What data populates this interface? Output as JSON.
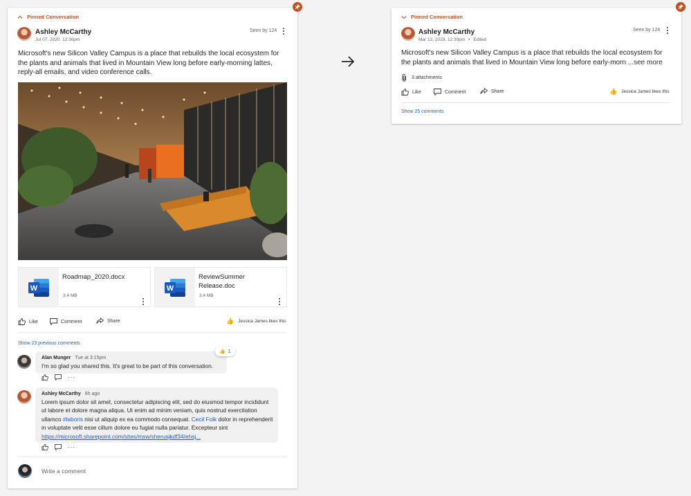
{
  "left_card": {
    "pinned_label": "Pinned Conversation",
    "author": "Ashley McCarthy",
    "timestamp": "Jul 07, 2020. 12:30pm",
    "seen": "Seen by 124",
    "body": "Microsoft's new Silicon Valley Campus is a place that rebuilds the local ecosystem for the plants and animals that lived in Mountain View long before early-morning lattes, reply-all emails, and video conference calls.",
    "attachments": [
      {
        "name": "Roadmap_2020.docx",
        "size": "3.4 MB"
      },
      {
        "name": "ReviewSummer Release.doc",
        "size": "3.4 MB"
      }
    ],
    "actions": {
      "like": "Like",
      "comment": "Comment",
      "share": "Share"
    },
    "likes_text": "Jessica James likes this",
    "previous_comments": "Show 23 previous comments",
    "comments": [
      {
        "author": "Alan Munger",
        "time": "Tue at 3:15pm",
        "text": "I'm so glad you shared this. It's great to be part of this conversation.",
        "reaction_count": "1"
      },
      {
        "author": "Ashley McCarthy",
        "time": "6h ago",
        "text_part1": "Lorem ipsum dolor sit amet, consectetur adipiscing elit, sed do eiusmod tempor incididunt ut labore et dolore magna aliqua. Ut enim ad minim veniam, quis nostrud exercitation ullamco ",
        "hashtag": "#laboris",
        "text_part2": " nisi ut aliquip ex ea commodo consequat. ",
        "mention": "Cecil Folk",
        "text_part3": " dolor in reprehenderit in voluptate velit esse cillum dolore eu fugiat nulla pariatur. Excepteur sint ",
        "link": "https://microsoft.sharepoint.com/sites/msw/sherusjkdf34/ehsj..."
      }
    ],
    "write_placeholder": "Write a comment"
  },
  "right_card": {
    "pinned_label": "Pinned Conversation",
    "author": "Ashley McCarthy",
    "timestamp": "Mar 12, 2019. 12:30pm",
    "edited": "Edited",
    "seen": "Seen by 124",
    "body": "Microsoft's new Silicon Valley Campus is a place that rebuilds the local ecosystem for the plants and animals that lived in Mountain View long before early-morn ...",
    "see_more": "see more",
    "attachments_label": "3 attachments",
    "actions": {
      "like": "Like",
      "comment": "Comment",
      "share": "Share"
    },
    "likes_text": "Jessica James likes this",
    "show_comments": "Show 25 comments"
  },
  "colors": {
    "accent": "#c4501a",
    "link": "#1e5bb7",
    "word_blue": "#185abd"
  },
  "icons": [
    "pin-icon",
    "chevron-up-icon",
    "chevron-down-icon",
    "more-vertical-icon",
    "like-icon",
    "comment-icon",
    "share-icon",
    "thumbs-up-icon",
    "word-icon",
    "paperclip-icon",
    "arrow-right-icon",
    "more-horizontal-icon"
  ]
}
